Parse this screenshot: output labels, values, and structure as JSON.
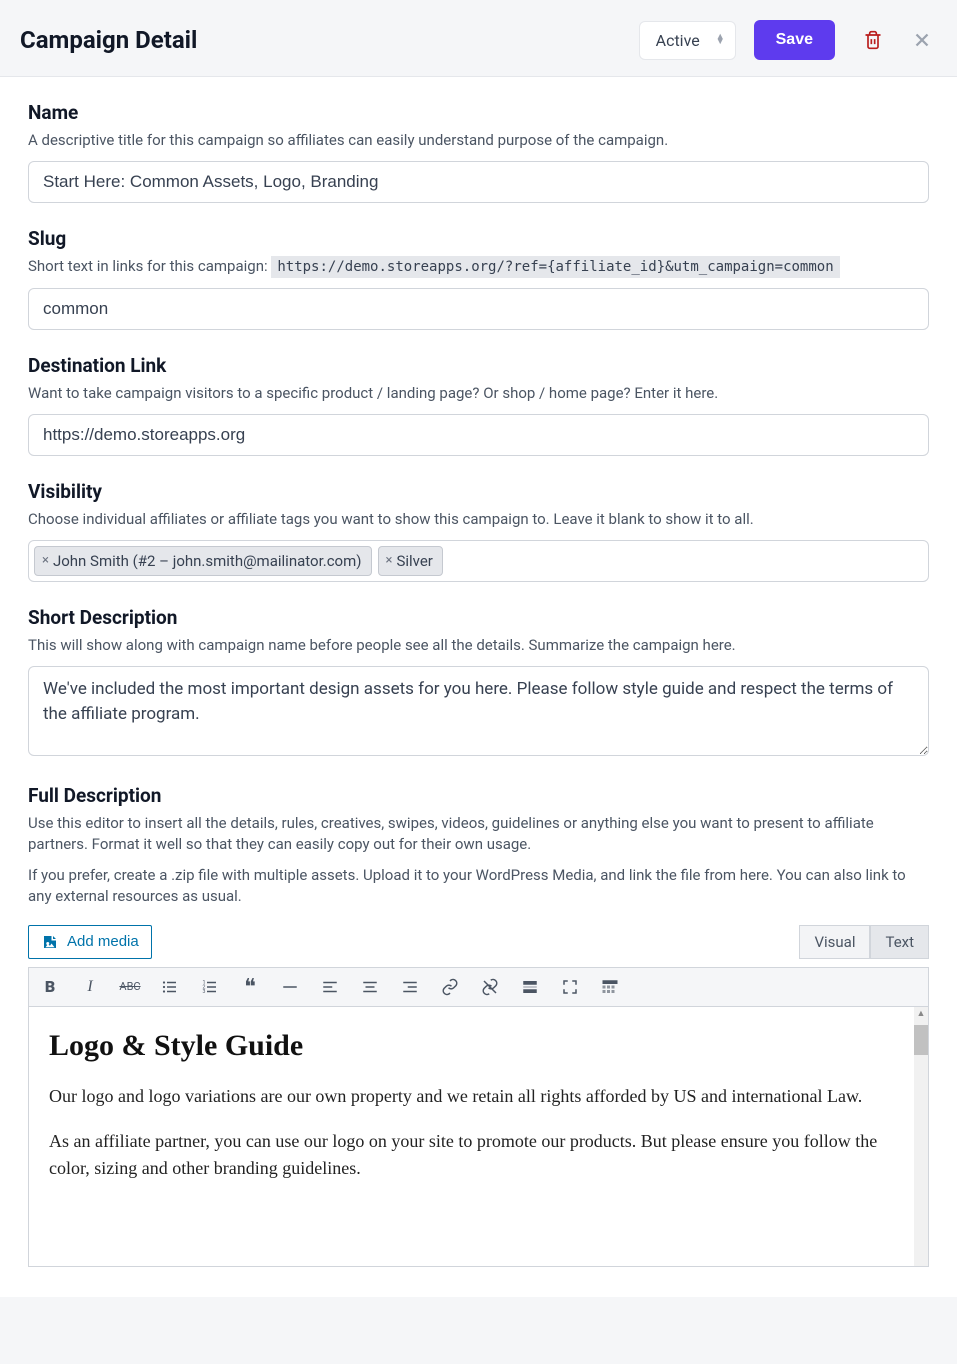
{
  "header": {
    "title": "Campaign Detail",
    "status_value": "Active",
    "save_label": "Save"
  },
  "name": {
    "label": "Name",
    "desc": "A descriptive title for this campaign so affiliates can easily understand purpose of the campaign.",
    "value": "Start Here: Common Assets, Logo, Branding"
  },
  "slug": {
    "label": "Slug",
    "desc_prefix": "Short text in links for this campaign: ",
    "url_example": "https://demo.storeapps.org/?ref={affiliate_id}&utm_campaign=common",
    "value": "common"
  },
  "dest": {
    "label": "Destination Link",
    "desc": "Want to take campaign visitors to a specific product / landing page? Or shop / home page? Enter it here.",
    "value": "https://demo.storeapps.org"
  },
  "visibility": {
    "label": "Visibility",
    "desc": "Choose individual affiliates or affiliate tags you want to show this campaign to. Leave it blank to show it to all.",
    "tags": [
      "John Smith (#2 – john.smith@mailinator.com)",
      "Silver"
    ]
  },
  "short_desc": {
    "label": "Short Description",
    "desc": "This will show along with campaign name before people see all the details. Summarize the campaign here.",
    "value": "We've included the most important design assets for you here. Please follow style guide and respect the terms of the affiliate program."
  },
  "full_desc": {
    "label": "Full Description",
    "desc1": "Use this editor to insert all the details, rules, creatives, swipes, videos, guidelines or anything else you want to present to affiliate partners. Format it well so that they can easily copy out for their own usage.",
    "desc2": "If you prefer, create a .zip file with multiple assets. Upload it to your WordPress Media, and link the file from here. You can also link to any external resources as usual.",
    "add_media_label": "Add media",
    "tab_visual": "Visual",
    "tab_text": "Text",
    "rich_heading": "Logo & Style Guide",
    "rich_p1": "Our logo and logo variations are our own property and we retain all rights afforded by US and international Law.",
    "rich_p2": "As an affiliate partner, you can use our logo on your site to promote our products. But please ensure you follow the color, sizing and other branding guidelines."
  }
}
